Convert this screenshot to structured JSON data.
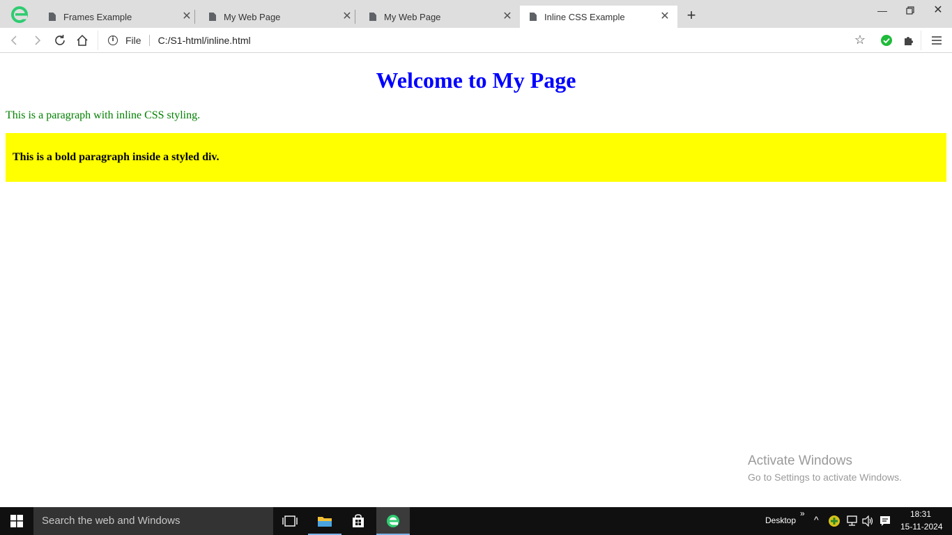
{
  "browser": {
    "tabs": [
      {
        "title": "Frames Example",
        "active": false
      },
      {
        "title": "My Web Page",
        "active": false
      },
      {
        "title": "My Web Page",
        "active": false
      },
      {
        "title": "Inline CSS Example",
        "active": true
      }
    ],
    "address": {
      "scheme_label": "File",
      "url": "C:/S1-html/inline.html"
    }
  },
  "page": {
    "heading": "Welcome to My Page",
    "paragraph": "This is a paragraph with inline CSS styling.",
    "div_paragraph": "This is a bold paragraph inside a styled div.",
    "colors": {
      "heading": "#0000ff",
      "paragraph": "#008000",
      "div_background": "#ffff00"
    }
  },
  "watermark": {
    "title": "Activate Windows",
    "subtitle": "Go to Settings to activate Windows."
  },
  "taskbar": {
    "search_placeholder": "Search the web and Windows",
    "desktop_label": "Desktop",
    "time": "18:31",
    "date": "15-11-2024"
  }
}
